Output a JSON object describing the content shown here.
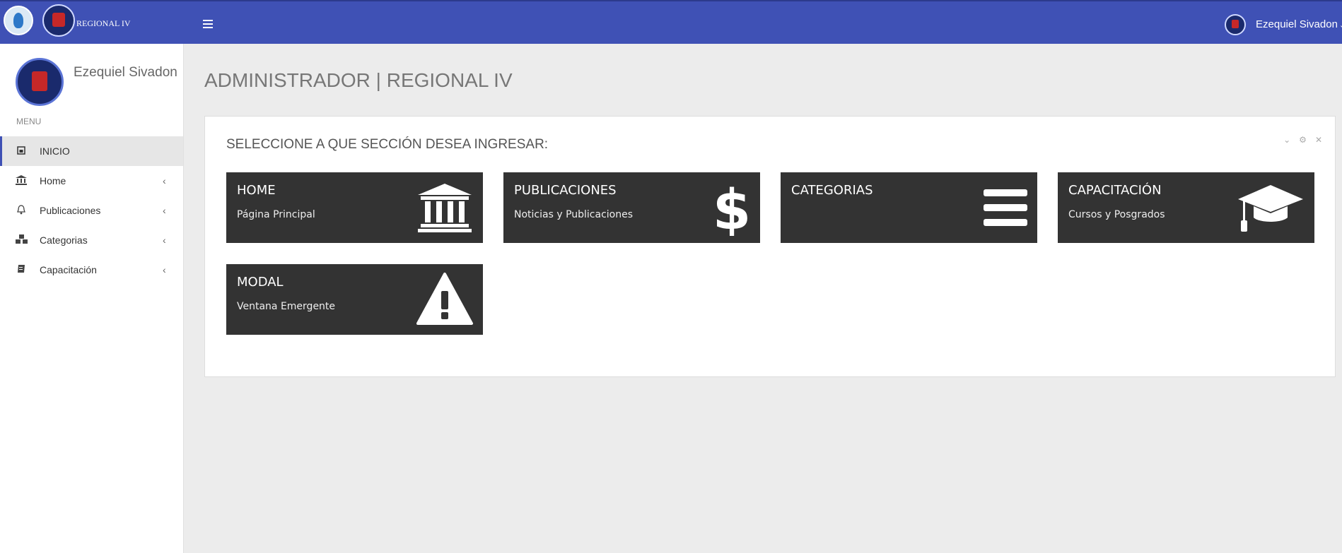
{
  "topbar": {
    "brand": "REGIONAL IV",
    "menu_icon": "hamburger-icon",
    "user_name": "Ezequiel Sivadon",
    "user_chevron": "⌄"
  },
  "sidebar": {
    "profile_name": "Ezequiel Sivadon",
    "menu_label": "MENU",
    "items": [
      {
        "label": "INICIO",
        "icon": "dashboard-icon",
        "active": true,
        "arrow": ""
      },
      {
        "label": "Home",
        "icon": "bank-icon",
        "active": false,
        "arrow": "‹"
      },
      {
        "label": "Publicaciones",
        "icon": "bell-icon",
        "active": false,
        "arrow": "‹"
      },
      {
        "label": "Categorias",
        "icon": "cubes-icon",
        "active": false,
        "arrow": "‹"
      },
      {
        "label": "Capacitación",
        "icon": "book-icon",
        "active": false,
        "arrow": "‹"
      }
    ]
  },
  "main": {
    "page_title": "ADMINISTRADOR | REGIONAL IV",
    "panel": {
      "heading": "SELECCIONE A QUE SECCIÓN DESEA INGRESAR:",
      "tools": {
        "collapse": "⌄",
        "settings": "⚙",
        "close": "✕"
      },
      "tiles": [
        {
          "title": "HOME",
          "subtitle": "Página Principal",
          "icon": "bank-icon"
        },
        {
          "title": "PUBLICACIONES",
          "subtitle": "Noticias y Publicaciones",
          "icon": "dollar-icon"
        },
        {
          "title": "CATEGORIAS",
          "subtitle": "",
          "icon": "list-icon"
        },
        {
          "title": "CAPACITACIÓN",
          "subtitle": "Cursos y Posgrados",
          "icon": "graduation-cap-icon"
        },
        {
          "title": "MODAL",
          "subtitle": "Ventana Emergente",
          "icon": "warning-icon"
        }
      ]
    }
  },
  "colors": {
    "topbar": "#3f51b5",
    "tile": "#333333",
    "background": "#ececec",
    "active_accent": "#3f51b5"
  }
}
